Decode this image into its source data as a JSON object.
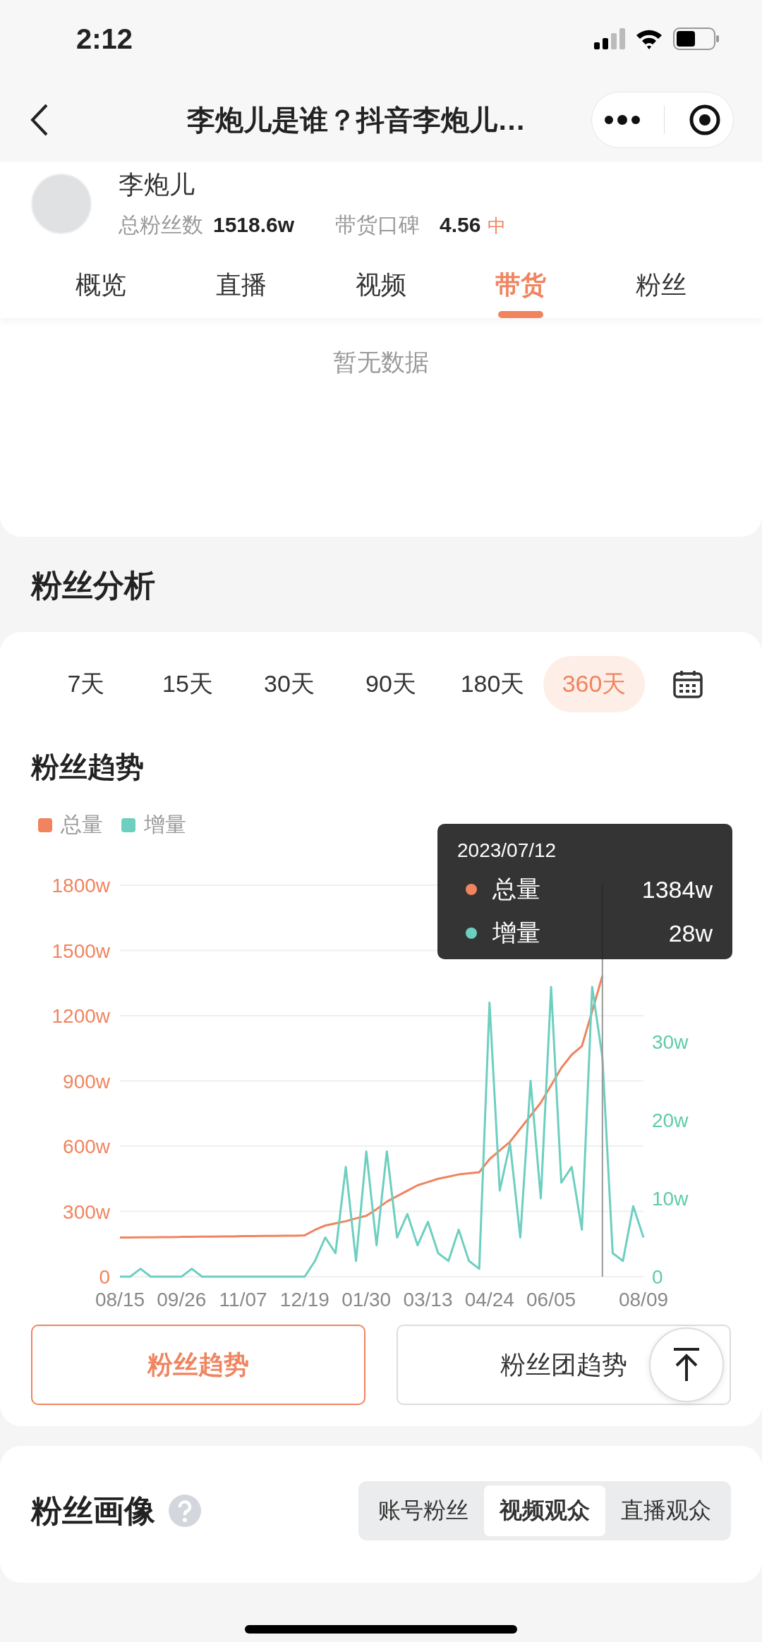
{
  "status_bar": {
    "time": "2:12"
  },
  "nav_bar": {
    "title": "李炮儿是谁？抖音李炮儿…"
  },
  "profile": {
    "name": "李炮儿",
    "fans_label": "总粉丝数",
    "fans_value": "1518.6w",
    "rating_label": "带货口碑",
    "rating_value": "4.56",
    "rating_level": "中"
  },
  "tabs": [
    {
      "label": "概览",
      "selected": false
    },
    {
      "label": "直播",
      "selected": false
    },
    {
      "label": "视频",
      "selected": false
    },
    {
      "label": "带货",
      "selected": true
    },
    {
      "label": "粉丝",
      "selected": false
    }
  ],
  "empty_text": "暂无数据",
  "fan_analysis": {
    "title": "粉丝分析",
    "periods": [
      {
        "label": "7天",
        "selected": false
      },
      {
        "label": "15天",
        "selected": false
      },
      {
        "label": "30天",
        "selected": false
      },
      {
        "label": "90天",
        "selected": false
      },
      {
        "label": "180天",
        "selected": false
      },
      {
        "label": "360天",
        "selected": true
      }
    ],
    "trend_title": "粉丝趋势",
    "chart_data": {
      "type": "line",
      "categories": [
        "08/15",
        null,
        null,
        null,
        null,
        null,
        "09/26",
        null,
        null,
        null,
        null,
        null,
        "11/07",
        null,
        null,
        null,
        null,
        null,
        "12/19",
        null,
        null,
        null,
        null,
        null,
        "01/30",
        null,
        null,
        null,
        null,
        null,
        "03/13",
        null,
        null,
        null,
        null,
        null,
        "04/24",
        null,
        null,
        null,
        null,
        null,
        "06/05",
        null,
        null,
        null,
        null,
        null,
        null,
        null,
        null,
        "08/09"
      ],
      "ylim": [
        0,
        1800
      ],
      "grid": true,
      "yticks": [
        {
          "value": 0,
          "label": "0"
        },
        {
          "value": 300,
          "label": "300w"
        },
        {
          "value": 600,
          "label": "600w"
        },
        {
          "value": 900,
          "label": "900w"
        },
        {
          "value": 1200,
          "label": "1200w"
        },
        {
          "value": 1500,
          "label": "1500w"
        },
        {
          "value": 1800,
          "label": "1800w"
        }
      ],
      "y2lim": [
        0,
        50
      ],
      "y2ticks": [
        {
          "value": 0,
          "label": "0"
        },
        {
          "value": 10,
          "label": "10w"
        },
        {
          "value": 20,
          "label": "20w"
        },
        {
          "value": 30,
          "label": "30w"
        }
      ],
      "series": [
        {
          "name": "总量",
          "color": "#f0845f",
          "values": [
            180,
            180,
            181,
            181,
            182,
            182,
            183,
            183,
            184,
            184,
            185,
            185,
            186,
            186,
            187,
            187,
            188,
            188,
            190,
            215,
            235,
            245,
            255,
            268,
            280,
            310,
            345,
            370,
            395,
            420,
            435,
            450,
            460,
            470,
            475,
            480,
            540,
            580,
            620,
            680,
            740,
            800,
            880,
            960,
            1020,
            1060,
            1220,
            1384,
            null,
            null,
            null,
            null
          ]
        },
        {
          "name": "增量",
          "color": "#6ccfc0",
          "axis": "y2",
          "values": [
            0,
            0,
            1,
            0,
            0,
            0,
            0,
            1,
            0,
            0,
            0,
            0,
            0,
            0,
            0,
            0,
            0,
            0,
            0,
            2,
            5,
            3,
            14,
            2,
            16,
            4,
            16,
            5,
            8,
            4,
            7,
            3,
            2,
            6,
            2,
            1,
            35,
            11,
            17,
            5,
            25,
            10,
            37,
            12,
            14,
            6,
            37,
            28,
            3,
            2,
            9,
            5
          ]
        }
      ]
    },
    "tooltip": {
      "date": "2023/07/12",
      "rows": [
        {
          "label": "总量",
          "value": "1384w",
          "color": "#f0845f"
        },
        {
          "label": "增量",
          "value": "28w",
          "color": "#6ccfc0"
        }
      ]
    },
    "buttons": [
      {
        "label": "粉丝趋势",
        "selected": true
      },
      {
        "label": "粉丝团趋势",
        "selected": false
      }
    ]
  },
  "portrait": {
    "title": "粉丝画像",
    "segments": [
      {
        "label": "账号粉丝",
        "selected": false
      },
      {
        "label": "视频观众",
        "selected": true
      },
      {
        "label": "直播观众",
        "selected": false
      }
    ]
  }
}
